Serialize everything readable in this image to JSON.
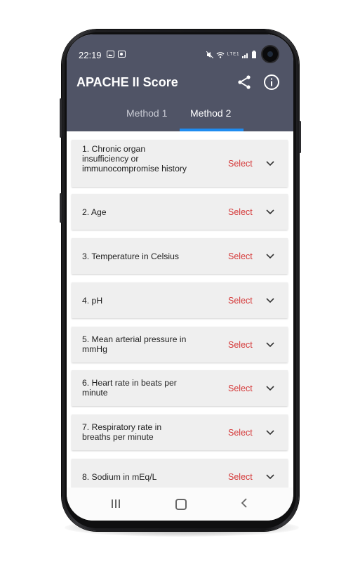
{
  "status_bar": {
    "time": "22:19",
    "network_text": "LTE1"
  },
  "app": {
    "title": "APACHE II Score"
  },
  "tabs": [
    {
      "label": "Method 1",
      "active": false
    },
    {
      "label": "Method 2",
      "active": true
    }
  ],
  "items": [
    {
      "label": "1. Chronic organ insufficiency or immunocompromise history",
      "action": "Select"
    },
    {
      "label": "2. Age",
      "action": "Select"
    },
    {
      "label": "3. Temperature in Celsius",
      "action": "Select"
    },
    {
      "label": "4. pH",
      "action": "Select"
    },
    {
      "label": "5. Mean arterial pressure in mmHg",
      "action": "Select"
    },
    {
      "label": "6. Heart rate in beats per minute",
      "action": "Select"
    },
    {
      "label": "7. Respiratory rate in breaths per minute",
      "action": "Select"
    },
    {
      "label": "8. Sodium in mEq/L",
      "action": "Select"
    }
  ],
  "icons": {
    "share": "share-icon",
    "info": "info-icon",
    "chevron": "chevron-down-icon",
    "nav_recent": "recent-apps-icon",
    "nav_home": "home-icon",
    "nav_back": "back-icon"
  },
  "colors": {
    "app_bar": "#505466",
    "tab_indicator": "#1f8cf0",
    "select_text": "#d53a3a",
    "card_background": "#efefef"
  }
}
